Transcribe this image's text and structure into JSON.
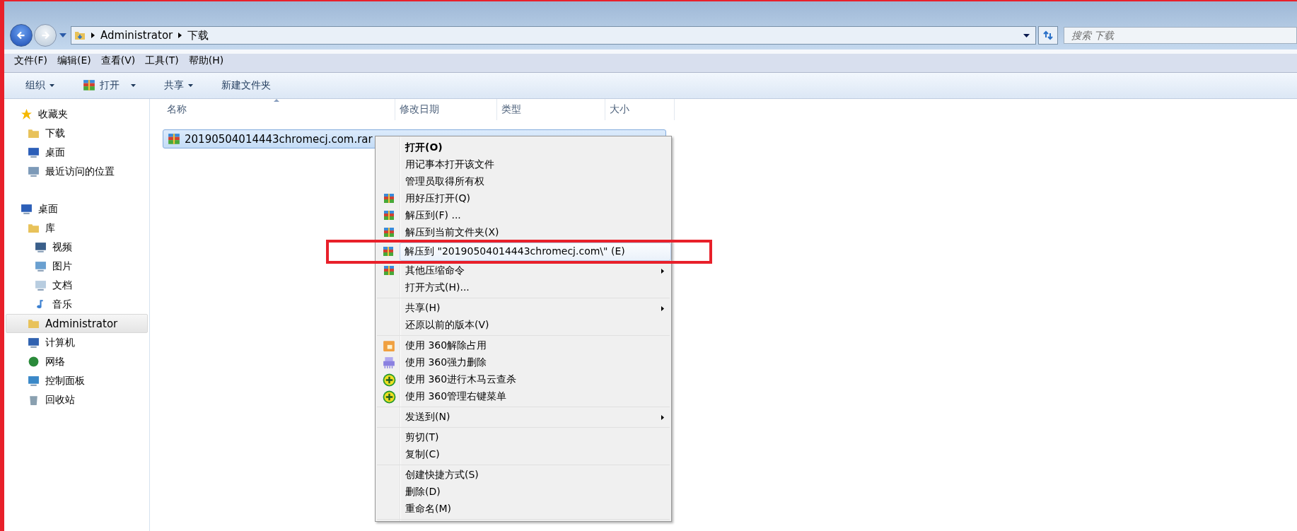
{
  "nav": {
    "back_enabled": true,
    "forward_enabled": false
  },
  "breadcrumb": [
    "Administrator",
    "下载"
  ],
  "search": {
    "placeholder": "搜索 下载"
  },
  "menubar": [
    "文件(F)",
    "编辑(E)",
    "查看(V)",
    "工具(T)",
    "帮助(H)"
  ],
  "toolbar": [
    {
      "label": "组织",
      "kind": "dropdown"
    },
    {
      "label": "打开",
      "kind": "icon-dropdown"
    },
    {
      "label": "共享",
      "kind": "dropdown"
    },
    {
      "label": "新建文件夹",
      "kind": "plain"
    }
  ],
  "sidebar": [
    {
      "label": "收藏夹",
      "selected": false,
      "children": [
        {
          "label": "下载",
          "selected": false
        },
        {
          "label": "桌面",
          "selected": false
        },
        {
          "label": "最近访问的位置",
          "selected": false
        }
      ]
    },
    {
      "label": "桌面",
      "selected": false,
      "children": [
        {
          "label": "库",
          "selected": false,
          "children": [
            {
              "label": "视频",
              "selected": false
            },
            {
              "label": "图片",
              "selected": false
            },
            {
              "label": "文档",
              "selected": false
            },
            {
              "label": "音乐",
              "selected": false
            }
          ]
        },
        {
          "label": "Administrator",
          "selected": true
        },
        {
          "label": "计算机",
          "selected": false
        },
        {
          "label": "网络",
          "selected": false
        },
        {
          "label": "控制面板",
          "selected": false
        },
        {
          "label": "回收站",
          "selected": false
        }
      ]
    }
  ],
  "table": {
    "columns": [
      {
        "label": "名称",
        "sorted": true
      },
      {
        "label": "修改日期",
        "sorted": false
      },
      {
        "label": "类型",
        "sorted": false
      },
      {
        "label": "大小",
        "sorted": false
      }
    ],
    "rows": [
      {
        "name": "20190504014443chromecj.com.rar",
        "selected": true
      }
    ]
  },
  "context_menu": [
    [
      {
        "label": "打开(O)",
        "bold": true,
        "submenu": false,
        "annotated": false
      },
      {
        "label": "用记事本打开该文件",
        "bold": false,
        "submenu": false,
        "annotated": false
      },
      {
        "label": "管理员取得所有权",
        "bold": false,
        "submenu": false,
        "annotated": false
      },
      {
        "label": "用好压打开(Q)",
        "bold": false,
        "submenu": false,
        "annotated": false
      },
      {
        "label": "解压到(F) ...",
        "bold": false,
        "submenu": false,
        "annotated": false
      },
      {
        "label": "解压到当前文件夹(X)",
        "bold": false,
        "submenu": false,
        "annotated": false
      },
      {
        "label": "解压到 \"20190504014443chromecj.com\\\" (E)",
        "bold": false,
        "submenu": false,
        "annotated": true
      },
      {
        "label": "其他压缩命令",
        "bold": false,
        "submenu": true,
        "annotated": false
      },
      {
        "label": "打开方式(H)...",
        "bold": false,
        "submenu": false,
        "annotated": false
      }
    ],
    [
      {
        "label": "共享(H)",
        "bold": false,
        "submenu": true,
        "annotated": false
      },
      {
        "label": "还原以前的版本(V)",
        "bold": false,
        "submenu": false,
        "annotated": false
      }
    ],
    [
      {
        "label": "使用 360解除占用",
        "bold": false,
        "submenu": false,
        "annotated": false
      },
      {
        "label": "使用 360强力删除",
        "bold": false,
        "submenu": false,
        "annotated": false
      },
      {
        "label": "使用 360进行木马云查杀",
        "bold": false,
        "submenu": false,
        "annotated": false
      },
      {
        "label": "使用 360管理右键菜单",
        "bold": false,
        "submenu": false,
        "annotated": false
      }
    ],
    [
      {
        "label": "发送到(N)",
        "bold": false,
        "submenu": true,
        "annotated": false
      }
    ],
    [
      {
        "label": "剪切(T)",
        "bold": false,
        "submenu": false,
        "annotated": false
      },
      {
        "label": "复制(C)",
        "bold": false,
        "submenu": false,
        "annotated": false
      }
    ],
    [
      {
        "label": "创建快捷方式(S)",
        "bold": false,
        "submenu": false,
        "annotated": false
      },
      {
        "label": "删除(D)",
        "bold": false,
        "submenu": false,
        "annotated": false
      },
      {
        "label": "重命名(M)",
        "bold": false,
        "submenu": false,
        "annotated": false
      }
    ]
  ]
}
